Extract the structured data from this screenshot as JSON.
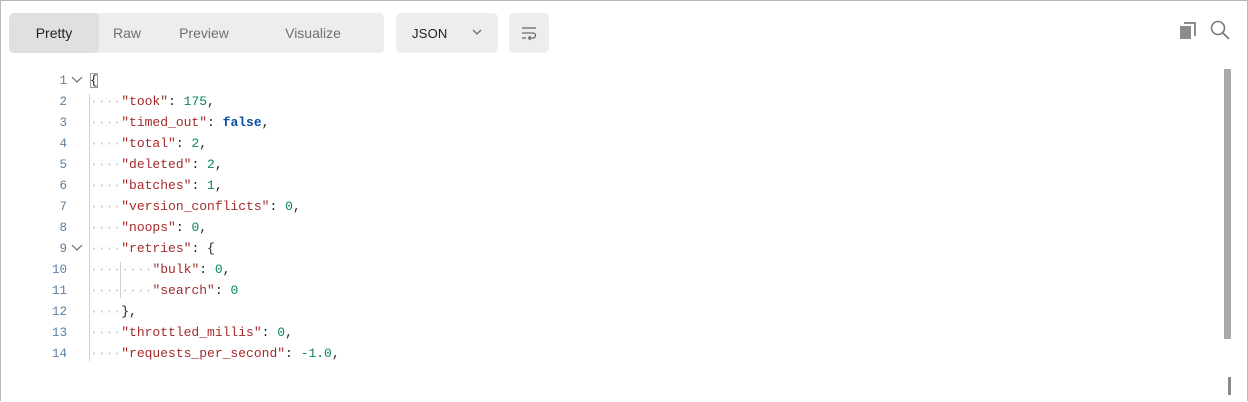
{
  "toolbar": {
    "view_tabs": [
      {
        "label": "Pretty",
        "active": true
      },
      {
        "label": "Raw",
        "active": false
      },
      {
        "label": "Preview",
        "active": false
      },
      {
        "label": "Visualize",
        "active": false
      }
    ],
    "format_select": {
      "value": "JSON",
      "icon": "chevron-down-icon"
    },
    "wrap_icon": "wrap-lines-icon",
    "copy_icon": "copy-icon",
    "search_icon": "search-icon"
  },
  "colors": {
    "key": "#a52a2a",
    "number": "#098658",
    "boolean": "#0451a5",
    "line_number": "#5a7fa3",
    "tab_bg": "#ededed"
  },
  "editor": {
    "lines": [
      {
        "n": "1",
        "indent": 0,
        "fold": true,
        "tokens": [
          {
            "t": "{",
            "c": "p"
          }
        ]
      },
      {
        "n": "2",
        "indent": 1,
        "fold": false,
        "tokens": [
          {
            "t": "\"took\"",
            "c": "k"
          },
          {
            "t": ": ",
            "c": "p"
          },
          {
            "t": "175",
            "c": "n"
          },
          {
            "t": ",",
            "c": "p"
          }
        ]
      },
      {
        "n": "3",
        "indent": 1,
        "fold": false,
        "tokens": [
          {
            "t": "\"timed_out\"",
            "c": "k"
          },
          {
            "t": ": ",
            "c": "p"
          },
          {
            "t": "false",
            "c": "b"
          },
          {
            "t": ",",
            "c": "p"
          }
        ]
      },
      {
        "n": "4",
        "indent": 1,
        "fold": false,
        "tokens": [
          {
            "t": "\"total\"",
            "c": "k"
          },
          {
            "t": ": ",
            "c": "p"
          },
          {
            "t": "2",
            "c": "n"
          },
          {
            "t": ",",
            "c": "p"
          }
        ]
      },
      {
        "n": "5",
        "indent": 1,
        "fold": false,
        "tokens": [
          {
            "t": "\"deleted\"",
            "c": "k"
          },
          {
            "t": ": ",
            "c": "p"
          },
          {
            "t": "2",
            "c": "n"
          },
          {
            "t": ",",
            "c": "p"
          }
        ]
      },
      {
        "n": "6",
        "indent": 1,
        "fold": false,
        "tokens": [
          {
            "t": "\"batches\"",
            "c": "k"
          },
          {
            "t": ": ",
            "c": "p"
          },
          {
            "t": "1",
            "c": "n"
          },
          {
            "t": ",",
            "c": "p"
          }
        ]
      },
      {
        "n": "7",
        "indent": 1,
        "fold": false,
        "tokens": [
          {
            "t": "\"version_conflicts\"",
            "c": "k"
          },
          {
            "t": ": ",
            "c": "p"
          },
          {
            "t": "0",
            "c": "n"
          },
          {
            "t": ",",
            "c": "p"
          }
        ]
      },
      {
        "n": "8",
        "indent": 1,
        "fold": false,
        "tokens": [
          {
            "t": "\"noops\"",
            "c": "k"
          },
          {
            "t": ": ",
            "c": "p"
          },
          {
            "t": "0",
            "c": "n"
          },
          {
            "t": ",",
            "c": "p"
          }
        ]
      },
      {
        "n": "9",
        "indent": 1,
        "fold": true,
        "tokens": [
          {
            "t": "\"retries\"",
            "c": "k"
          },
          {
            "t": ": ",
            "c": "p"
          },
          {
            "t": "{",
            "c": "p"
          }
        ]
      },
      {
        "n": "10",
        "indent": 2,
        "fold": false,
        "tokens": [
          {
            "t": "\"bulk\"",
            "c": "k"
          },
          {
            "t": ": ",
            "c": "p"
          },
          {
            "t": "0",
            "c": "n"
          },
          {
            "t": ",",
            "c": "p"
          }
        ]
      },
      {
        "n": "11",
        "indent": 2,
        "fold": false,
        "tokens": [
          {
            "t": "\"search\"",
            "c": "k"
          },
          {
            "t": ": ",
            "c": "p"
          },
          {
            "t": "0",
            "c": "n"
          }
        ]
      },
      {
        "n": "12",
        "indent": 1,
        "fold": false,
        "tokens": [
          {
            "t": "}",
            "c": "p"
          },
          {
            "t": ",",
            "c": "p"
          }
        ]
      },
      {
        "n": "13",
        "indent": 1,
        "fold": false,
        "tokens": [
          {
            "t": "\"throttled_millis\"",
            "c": "k"
          },
          {
            "t": ": ",
            "c": "p"
          },
          {
            "t": "0",
            "c": "n"
          },
          {
            "t": ",",
            "c": "p"
          }
        ]
      },
      {
        "n": "14",
        "indent": 1,
        "fold": false,
        "tokens": [
          {
            "t": "\"requests_per_second\"",
            "c": "k"
          },
          {
            "t": ": ",
            "c": "p"
          },
          {
            "t": "-1.0",
            "c": "n"
          },
          {
            "t": ",",
            "c": "p"
          }
        ]
      }
    ]
  }
}
